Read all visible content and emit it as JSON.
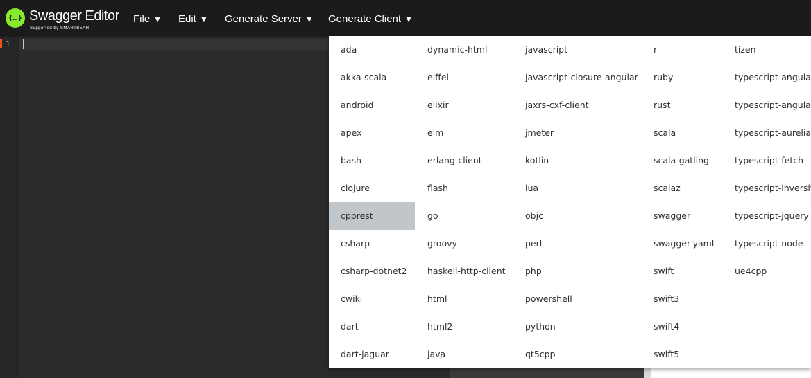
{
  "app": {
    "logo_glyph": "{…}",
    "title": "Swagger Editor",
    "subtitle": "Supported by SMARTBEAR"
  },
  "menu": {
    "items": [
      {
        "label": "File"
      },
      {
        "label": "Edit"
      },
      {
        "label": "Generate Server"
      },
      {
        "label": "Generate Client"
      }
    ],
    "caret": "▼"
  },
  "editor": {
    "line_numbers": [
      "1"
    ]
  },
  "client_menu": {
    "highlighted": "cpprest",
    "columns": [
      [
        "ada",
        "akka-scala",
        "android",
        "apex",
        "bash",
        "clojure",
        "cpprest",
        "csharp",
        "csharp-dotnet2",
        "cwiki",
        "dart",
        "dart-jaguar"
      ],
      [
        "dynamic-html",
        "eiffel",
        "elixir",
        "elm",
        "erlang-client",
        "flash",
        "go",
        "groovy",
        "haskell-http-client",
        "html",
        "html2",
        "java"
      ],
      [
        "javascript",
        "javascript-closure-angular",
        "jaxrs-cxf-client",
        "jmeter",
        "kotlin",
        "lua",
        "objc",
        "perl",
        "php",
        "powershell",
        "python",
        "qt5cpp"
      ],
      [
        "r",
        "ruby",
        "rust",
        "scala",
        "scala-gatling",
        "scalaz",
        "swagger",
        "swagger-yaml",
        "swift",
        "swift3",
        "swift4",
        "swift5"
      ],
      [
        "tizen",
        "typescript-angular",
        "typescript-angularjs",
        "typescript-aurelia",
        "typescript-fetch",
        "typescript-inversify",
        "typescript-jquery",
        "typescript-node",
        "ue4cpp"
      ]
    ]
  },
  "colors": {
    "topbar": "#1b1b1b",
    "logo_accent": "#85ea2d",
    "editor_bg": "#2b2b2b",
    "highlight": "#c1c6ca"
  }
}
